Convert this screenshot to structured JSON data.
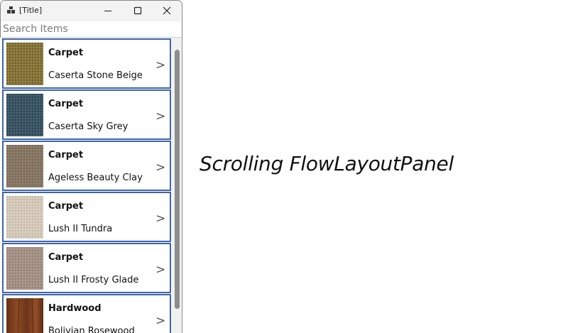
{
  "window": {
    "title": "[Title]",
    "icon": "app-windows-icon",
    "controls": [
      "minimize-icon",
      "maximize-icon",
      "close-icon"
    ]
  },
  "search": {
    "placeholder": "Search Items",
    "value": ""
  },
  "items": [
    {
      "category": "Carpet",
      "name": "Caserta Stone Beige",
      "chevron": ">",
      "swatch_color": "#8a7a3e"
    },
    {
      "category": "Carpet",
      "name": "Caserta Sky Grey",
      "chevron": ">",
      "swatch_color": "#3e5968"
    },
    {
      "category": "Carpet",
      "name": "Ageless Beauty Clay",
      "chevron": ">",
      "swatch_color": "#8a7a66"
    },
    {
      "category": "Carpet",
      "name": "Lush II Tundra",
      "chevron": ">",
      "swatch_color": "#d6cbbc"
    },
    {
      "category": "Carpet",
      "name": "Lush II Frosty Glade",
      "chevron": ">",
      "swatch_color": "#a8958a"
    },
    {
      "category": "Hardwood",
      "name": "Bolivian Rosewood",
      "chevron": ">",
      "swatch_color": "#7a3e1e"
    }
  ],
  "caption": "Scrolling FlowLayoutPanel",
  "colors": {
    "card_border": "#3d65aa",
    "scroll_thumb": "#8d8d8d"
  }
}
